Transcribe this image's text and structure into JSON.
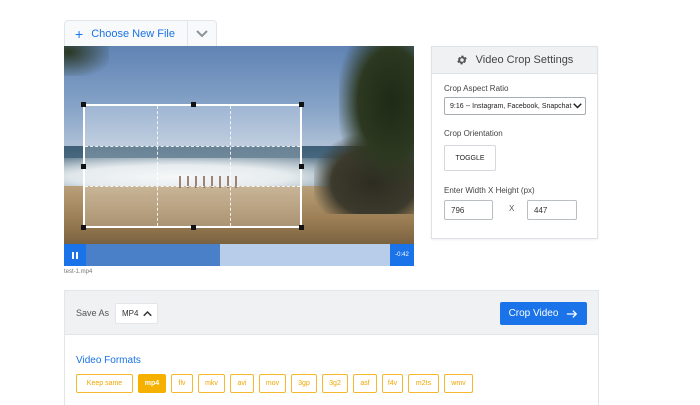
{
  "file_menu": {
    "choose_label": "Choose New File",
    "plus_icon": "plus-icon",
    "dropdown_icon": "chevron-down-icon"
  },
  "player": {
    "time_remaining": "-0:42",
    "file_name": "test-1.mp4",
    "progress": 0.44,
    "pause_icon": "pause-icon"
  },
  "settings": {
    "title": "Video Crop Settings",
    "title_icon": "gear-icon",
    "aspect_label": "Crop Aspect Ratio",
    "aspect_value": "9:16 -- Instagram, Facebook, Snapchat",
    "orientation_label": "Crop Orientation",
    "toggle_label": "TOGGLE",
    "size_label": "Enter Width X Height (px)",
    "width": "796",
    "separator": "X",
    "height": "447"
  },
  "export": {
    "save_as_label": "Save As",
    "selected_format": "MP4",
    "crop_button": "Crop Video",
    "crop_icon": "arrow-right-icon",
    "formats_title": "Video Formats",
    "formats": [
      "Keep same",
      "mp4",
      "flv",
      "mkv",
      "avi",
      "mov",
      "3gp",
      "3g2",
      "asf",
      "f4v",
      "m2ts",
      "wmv"
    ],
    "active_format": "mp4"
  },
  "colors": {
    "accent": "#1a73e8",
    "format_chip": "#f5b000"
  }
}
